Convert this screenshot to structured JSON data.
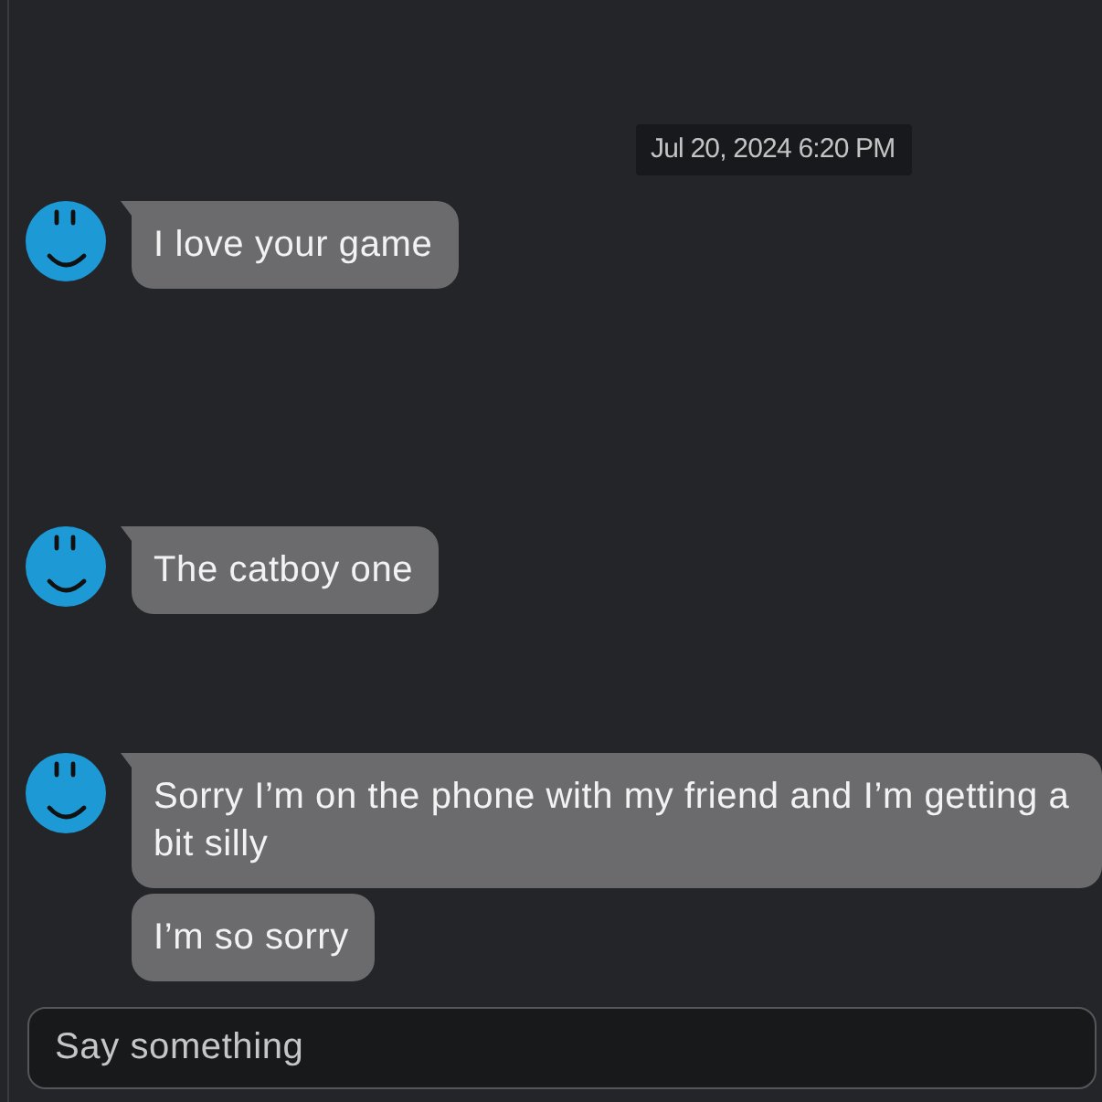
{
  "timestamp": "Jul 20, 2024 6:20 PM",
  "message_groups": [
    {
      "messages": [
        "I love your game"
      ]
    },
    {
      "messages": [
        "The catboy one"
      ]
    },
    {
      "messages": [
        "Sorry I’m on the phone with my friend and I’m getting a bit silly",
        "I’m so sorry"
      ]
    }
  ],
  "composer": {
    "placeholder": "Say something"
  }
}
